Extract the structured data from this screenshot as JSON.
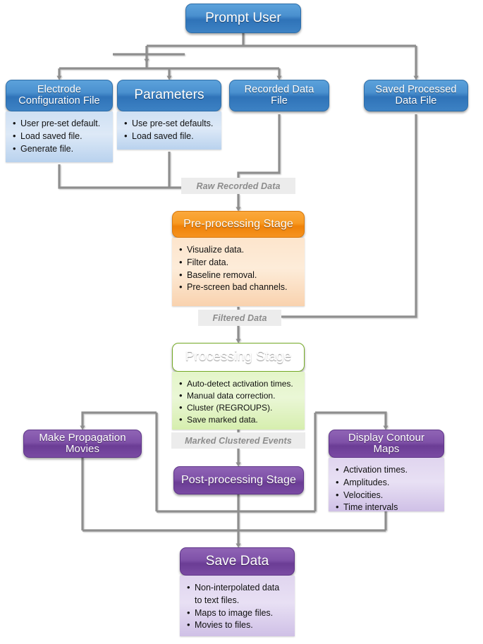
{
  "diagram": {
    "title": "Prompt User",
    "line_color": "#8e8e8e",
    "nodes": {
      "prompt_user": {
        "label": "Prompt User",
        "color": "#3d82c4"
      },
      "electrode": {
        "label": "Electrode\nConfiguration File",
        "color": "#3d82c4",
        "items": [
          "User pre-set default.",
          "Load saved file.",
          "Generate file."
        ]
      },
      "parameters": {
        "label": "Parameters",
        "color": "#3d82c4",
        "items": [
          "Use pre-set defaults.",
          "Load saved file."
        ]
      },
      "recorded": {
        "label": "Recorded Data\nFile",
        "color": "#3d82c4",
        "items": []
      },
      "saved_processed": {
        "label": "Saved Processed\nData File",
        "color": "#3d82c4",
        "items": []
      },
      "preprocessing": {
        "label": "Pre-processing Stage",
        "color": "#f69320",
        "items": [
          "Visualize data.",
          "Filter data.",
          "Baseline removal.",
          "Pre-screen bad channels."
        ]
      },
      "processing": {
        "label": "Processing Stage",
        "color": "#8cc238",
        "items": [
          "Auto-detect activation times.",
          "Manual data correction.",
          "Cluster (REGROUPS).",
          "Save marked data."
        ]
      },
      "movies": {
        "label": "Make Propagation\nMovies",
        "color": "#7a4ba3",
        "items": []
      },
      "contour": {
        "label": "Display Contour\nMaps",
        "color": "#7a4ba3",
        "items": [
          "Activation times.",
          "Amplitudes.",
          "Velocities.",
          "Time intervals"
        ]
      },
      "postprocessing": {
        "label": "Post-processing Stage",
        "color": "#7a4ba3",
        "items": []
      },
      "save_data": {
        "label": "Save Data",
        "color": "#7a4ba3",
        "items": [
          "Non-interpolated data to text files.",
          "Maps to image files.",
          "Movies to files."
        ]
      }
    },
    "edge_labels": {
      "raw_recorded": "Raw Recorded Data",
      "filtered": "Filtered Data",
      "marked": "Marked Clustered Events"
    }
  }
}
